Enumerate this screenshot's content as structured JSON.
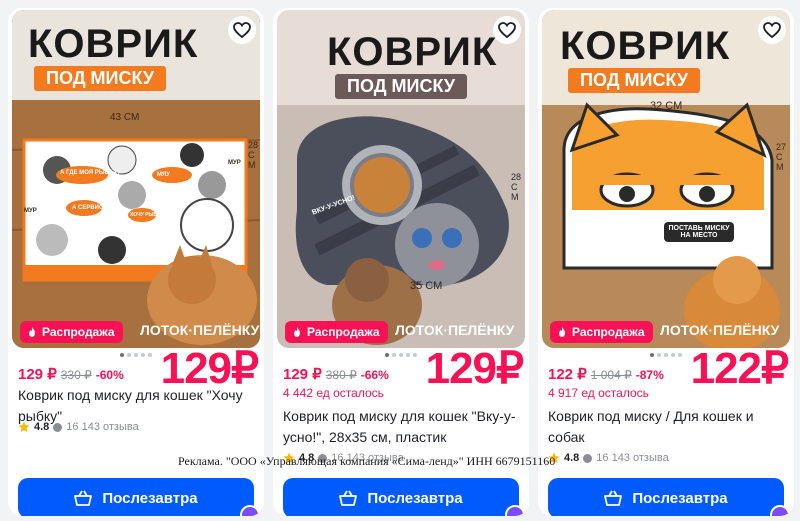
{
  "cards": [
    {
      "headline": "КОВРИК",
      "subline": "ПОД МИСКУ",
      "dim_width": "43 СМ",
      "dim_height": "28 СМ",
      "sale_badge": "Распродажа",
      "price_now": "129 ₽",
      "price_old": "330 ₽",
      "discount": "-60%",
      "big_price": "129₽",
      "stock": "",
      "title": "Коврик под миску для кошек \"Хочу рыбку\"",
      "rating": "4.8",
      "reviews": "16 143 отзыва",
      "cta": "Послезавтра",
      "bubbles": [
        "МУР",
        "МЯУ",
        "А ГДЕ МОЯ РЫБКА?",
        "МУР",
        "А СЕРВИС?",
        "ХОЧУ РЫБКУ!",
        "ЛОТОК·ПЕЛЁНКУ"
      ]
    },
    {
      "headline": "КОВРИК",
      "subline": "ПОД МИСКУ",
      "dim_width": "35 СМ",
      "dim_height": "28 СМ",
      "sale_badge": "Распродажа",
      "price_now": "129 ₽",
      "price_old": "380 ₽",
      "discount": "-66%",
      "big_price": "129₽",
      "stock": "4 442 ед осталось",
      "title": "Коврик под миску для кошек \"Вку-у-усно!\", 28x35 см, пластик",
      "rating": "4.8",
      "reviews": "16 143 отзыва",
      "cta": "Послезавтра",
      "bubbles": [
        "ВКУ-У-УСНО!",
        "ЛОТОК·ПЕЛЁНКУ"
      ]
    },
    {
      "headline": "КОВРИК",
      "subline": "ПОД МИСКУ",
      "dim_width": "32 СМ",
      "dim_height": "27 СМ",
      "sale_badge": "Распродажа",
      "price_now": "122 ₽",
      "price_old": "1 004 ₽",
      "discount": "-87%",
      "big_price": "122₽",
      "stock": "4 917 ед осталось",
      "title": "Коврик под миску / Для кошек и собак",
      "rating": "4.8",
      "reviews": "16 143 отзыва",
      "cta": "Послезавтра",
      "bubbles": [
        "ПОСТАВЬ МИСКУ НА МЕСТО",
        "ЛОТОК·ПЕЛЁНКУ"
      ]
    }
  ],
  "ad_notice": "Реклама. \"ООО «Управляющая компания «Сима-ленд»\" ИНН 6679151160",
  "colors": {
    "accent": "#f91155",
    "cta": "#005bff",
    "star": "#ffb800",
    "mat_orange": "#f47a1f"
  },
  "icons": [
    "heart-icon",
    "flame-icon",
    "star-icon",
    "basket-icon",
    "seller-logo-icon"
  ]
}
